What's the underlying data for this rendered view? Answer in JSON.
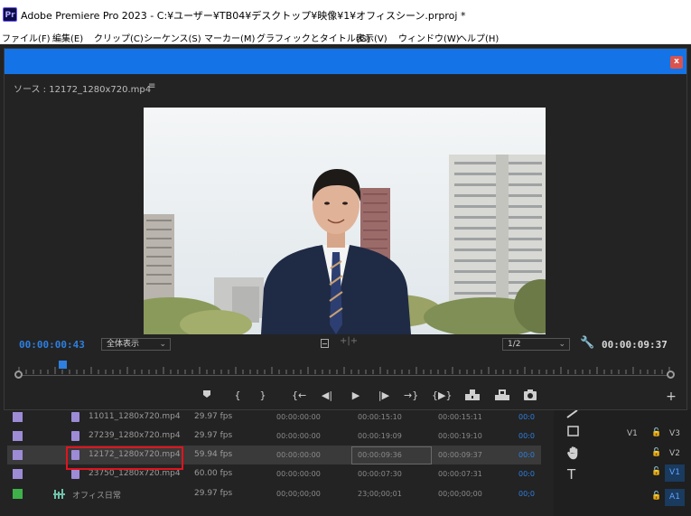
{
  "window": {
    "logo": "Pr",
    "title": "Adobe Premiere Pro 2023 - C:¥ユーザー¥TB04¥デスクトップ¥映像¥1¥オフィスシーン.prproj *"
  },
  "menu": [
    "ファイル(F)",
    "編集(E)",
    "クリップ(C)",
    "シーケンス(S)",
    "マーカー(M)",
    "グラフィックとタイトル(G)",
    "表示(V)",
    "ウィンドウ(W)",
    "ヘルプ(H)"
  ],
  "source_monitor": {
    "close_label": "x",
    "source_label": "ソース : 12172_1280x720.mp4",
    "menu_glyph": "≡",
    "timecode_in": "00:00:00:43",
    "zoom_select": "全体表示",
    "resolution_select": "1/2",
    "timecode_duration": "00:00:09:37"
  },
  "transport_icons": [
    "add-marker-icon",
    "mark-in-icon",
    "mark-out-icon",
    "go-to-in-icon",
    "step-back-icon",
    "play-icon",
    "step-forward-icon",
    "go-to-out-icon",
    "play-in-to-out-icon",
    "insert-icon",
    "overwrite-icon",
    "export-frame-icon",
    "add-button-icon"
  ],
  "clips": [
    {
      "name": "11011_1280x720.mp4",
      "fps": "29.97 fps",
      "start": "00:00:00:00",
      "end": "00:00:15:10",
      "duration": "00:00:15:11",
      "extra": "00:0",
      "swatch": "#9d8bd6",
      "selected": false
    },
    {
      "name": "27239_1280x720.mp4",
      "fps": "29.97 fps",
      "start": "00:00:00:00",
      "end": "00:00:19:09",
      "duration": "00:00:19:10",
      "extra": "00:0",
      "swatch": "#9d8bd6",
      "selected": false
    },
    {
      "name": "12172_1280x720.mp4",
      "fps": "59.94 fps",
      "start": "00:00:00:00",
      "end": "00:00:09:36",
      "duration": "00:00:09:37",
      "extra": "00:0",
      "swatch": "#9d8bd6",
      "selected": true
    },
    {
      "name": "23750_1280x720.mp4",
      "fps": "60.00 fps",
      "start": "00:00:00:00",
      "end": "00:00:07:30",
      "duration": "00:00:07:31",
      "extra": "00:0",
      "swatch": "#9d8bd6",
      "selected": false
    },
    {
      "name": "オフィス日常",
      "fps": "29.97 fps",
      "start": "00;00;00;00",
      "end": "23;00;00;01",
      "duration": "00;00;00;00",
      "extra": "00;0",
      "swatch": "#3fb14a",
      "selected": false
    }
  ],
  "tools": [
    "razor-icon",
    "rectangle-icon",
    "hand-icon",
    "type-icon"
  ],
  "tracks": [
    {
      "src": "V1",
      "name": "V3",
      "active": false
    },
    {
      "src": "",
      "name": "V2",
      "active": false
    },
    {
      "src": "",
      "name": "V1",
      "active": true
    },
    {
      "src": "",
      "name": "A1",
      "active": true
    }
  ],
  "colors": {
    "accent_blue": "#1473e6",
    "timecode_blue": "#2e7fe0",
    "highlight_red": "#e0141e"
  }
}
